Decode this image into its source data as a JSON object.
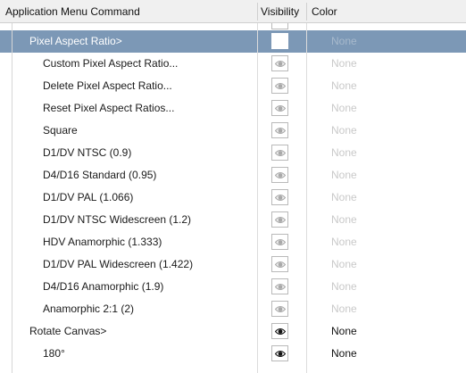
{
  "header": {
    "command_label": "Application Menu Command",
    "visibility_label": "Visibility",
    "color_label": "Color"
  },
  "rows": [
    {
      "label": "Pixel Aspect Ratio>",
      "indent": 1,
      "selected": true,
      "visible": false,
      "eye": false,
      "color": "None",
      "color_active": false
    },
    {
      "label": "Custom Pixel Aspect Ratio...",
      "indent": 2,
      "selected": false,
      "visible": false,
      "eye": true,
      "color": "None",
      "color_active": false
    },
    {
      "label": "Delete Pixel Aspect Ratio...",
      "indent": 2,
      "selected": false,
      "visible": false,
      "eye": true,
      "color": "None",
      "color_active": false
    },
    {
      "label": "Reset Pixel Aspect Ratios...",
      "indent": 2,
      "selected": false,
      "visible": false,
      "eye": true,
      "color": "None",
      "color_active": false
    },
    {
      "label": "Square",
      "indent": 2,
      "selected": false,
      "visible": false,
      "eye": true,
      "color": "None",
      "color_active": false
    },
    {
      "label": "D1/DV NTSC (0.9)",
      "indent": 2,
      "selected": false,
      "visible": false,
      "eye": true,
      "color": "None",
      "color_active": false
    },
    {
      "label": "D4/D16 Standard (0.95)",
      "indent": 2,
      "selected": false,
      "visible": false,
      "eye": true,
      "color": "None",
      "color_active": false
    },
    {
      "label": "D1/DV PAL (1.066)",
      "indent": 2,
      "selected": false,
      "visible": false,
      "eye": true,
      "color": "None",
      "color_active": false
    },
    {
      "label": "D1/DV NTSC Widescreen (1.2)",
      "indent": 2,
      "selected": false,
      "visible": false,
      "eye": true,
      "color": "None",
      "color_active": false
    },
    {
      "label": "HDV Anamorphic (1.333)",
      "indent": 2,
      "selected": false,
      "visible": false,
      "eye": true,
      "color": "None",
      "color_active": false
    },
    {
      "label": "D1/DV PAL Widescreen (1.422)",
      "indent": 2,
      "selected": false,
      "visible": false,
      "eye": true,
      "color": "None",
      "color_active": false
    },
    {
      "label": "D4/D16 Anamorphic (1.9)",
      "indent": 2,
      "selected": false,
      "visible": false,
      "eye": true,
      "color": "None",
      "color_active": false
    },
    {
      "label": "Anamorphic 2:1 (2)",
      "indent": 2,
      "selected": false,
      "visible": false,
      "eye": true,
      "color": "None",
      "color_active": false
    },
    {
      "label": "Rotate Canvas>",
      "indent": 1,
      "selected": false,
      "visible": true,
      "eye": true,
      "color": "None",
      "color_active": true
    },
    {
      "label": "180°",
      "indent": 2,
      "selected": false,
      "visible": true,
      "eye": true,
      "color": "None",
      "color_active": true
    }
  ],
  "colors": {
    "selected_bg": "#7c98b6",
    "eye_on": "#111111",
    "eye_off": "#a9a9a9",
    "color_dim": "#c9c9c9"
  }
}
